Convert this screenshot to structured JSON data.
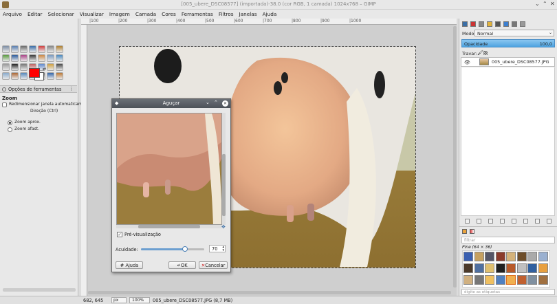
{
  "window": {
    "title": "[005_ubere_DSC08577] (importada)-38.0 (cor RGB, 1 camada) 1024x768 – GIMP"
  },
  "menu": [
    "Arquivo",
    "Editar",
    "Selecionar",
    "Visualizar",
    "Imagem",
    "Camada",
    "Cores",
    "Ferramentas",
    "Filtros",
    "Janelas",
    "Ajuda"
  ],
  "toolbox": {
    "tab_label": "Opções de ferramentas",
    "tool_title": "Zoom",
    "resize_label": "Redimensionar janela automaticamente",
    "direction_label": "Direção (Ctrl)",
    "zoom_in_label": "Zoom aprox.",
    "zoom_out_label": "Zoom afast.",
    "fg_color": "#ff0000",
    "bg_color": "#ffffff"
  },
  "ruler": {
    "ticks": [
      "|100",
      "|200",
      "|300",
      "|400",
      "|500",
      "|600",
      "|700",
      "|800",
      "|900",
      "|1000"
    ]
  },
  "layers": {
    "mode_label": "Modo:",
    "mode_value": "Normal",
    "opacity_label": "Opacidade",
    "opacity_value": "100,0",
    "opacity_fraction": 1.0,
    "lock_label": "Travar:",
    "layer_name": "005_ubere_DSC08577.JPG"
  },
  "patterns": {
    "filter_placeholder": "filtrar",
    "pattern_name": "Pine (64 × 36)",
    "tag_placeholder": "digite as etiquetas"
  },
  "dialog": {
    "title": "Aguçar",
    "preview_label": "Pré-visualização",
    "sharpness_label": "Acuidade:",
    "sharpness_value": "70",
    "sharpness_fraction": 0.7,
    "help_label": "Ajuda",
    "ok_label": "OK",
    "cancel_label": "Cancelar"
  },
  "status": {
    "coords": "682, 645",
    "unit": "px",
    "zoom": "100%",
    "file_info": "005_ubere_DSC08577.JPG (8,7 MB)"
  }
}
